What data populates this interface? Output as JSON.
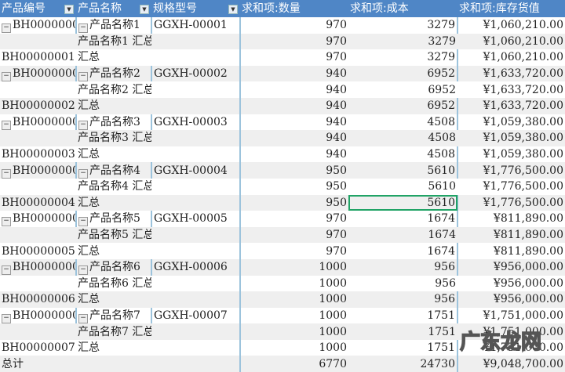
{
  "headers": [
    "产品编号",
    "产品名称",
    "规格型号",
    "求和项:数量",
    "求和项:成本",
    "求和项:库存货值"
  ],
  "rows": [
    {
      "c0": "BH0000000",
      "c0m": true,
      "c1": "产品名称1",
      "c1m": true,
      "c2": "GGXH-00001",
      "q": "970",
      "cost": "3279",
      "val": "¥1,060,210.00"
    },
    {
      "c0": "",
      "c1": "产品名称1 汇总",
      "c2": "",
      "q": "970",
      "cost": "3279",
      "val": "¥1,060,210.00"
    },
    {
      "c0": "BH00000001",
      "c1": "汇总",
      "c2": "",
      "q": "970",
      "cost": "3279",
      "val": "¥1,060,210.00"
    },
    {
      "c0": "BH0000000",
      "c0m": true,
      "c1": "产品名称2",
      "c1m": true,
      "c2": "GGXH-00002",
      "q": "940",
      "cost": "6952",
      "val": "¥1,633,720.00"
    },
    {
      "c0": "",
      "c1": "产品名称2 汇总",
      "c2": "",
      "q": "940",
      "cost": "6952",
      "val": "¥1,633,720.00"
    },
    {
      "c0": "BH00000002",
      "c1": "汇总",
      "c2": "",
      "q": "940",
      "cost": "6952",
      "val": "¥1,633,720.00"
    },
    {
      "c0": "BH0000000",
      "c0m": true,
      "c1": "产品名称3",
      "c1m": true,
      "c2": "GGXH-00003",
      "q": "940",
      "cost": "4508",
      "val": "¥1,059,380.00"
    },
    {
      "c0": "",
      "c1": "产品名称3 汇总",
      "c2": "",
      "q": "940",
      "cost": "4508",
      "val": "¥1,059,380.00"
    },
    {
      "c0": "BH00000003",
      "c1": "汇总",
      "c2": "",
      "q": "940",
      "cost": "4508",
      "val": "¥1,059,380.00"
    },
    {
      "c0": "BH0000000",
      "c0m": true,
      "c1": "产品名称4",
      "c1m": true,
      "c2": "GGXH-00004",
      "q": "950",
      "cost": "5610",
      "val": "¥1,776,500.00"
    },
    {
      "c0": "",
      "c1": "产品名称4 汇总",
      "c2": "",
      "q": "950",
      "cost": "5610",
      "val": "¥1,776,500.00"
    },
    {
      "c0": "BH00000004",
      "c1": "汇总",
      "c2": "",
      "q": "950",
      "cost": "5610",
      "val": "¥1,776,500.00",
      "selected": true
    },
    {
      "c0": "BH0000000",
      "c0m": true,
      "c1": "产品名称5",
      "c1m": true,
      "c2": "GGXH-00005",
      "q": "970",
      "cost": "1674",
      "val": "¥811,890.00"
    },
    {
      "c0": "",
      "c1": "产品名称5 汇总",
      "c2": "",
      "q": "970",
      "cost": "1674",
      "val": "¥811,890.00"
    },
    {
      "c0": "BH00000005",
      "c1": "汇总",
      "c2": "",
      "q": "970",
      "cost": "1674",
      "val": "¥811,890.00"
    },
    {
      "c0": "BH0000000",
      "c0m": true,
      "c1": "产品名称6",
      "c1m": true,
      "c2": "GGXH-00006",
      "q": "1000",
      "cost": "956",
      "val": "¥956,000.00"
    },
    {
      "c0": "",
      "c1": "产品名称6 汇总",
      "c2": "",
      "q": "1000",
      "cost": "956",
      "val": "¥956,000.00"
    },
    {
      "c0": "BH00000006",
      "c1": "汇总",
      "c2": "",
      "q": "1000",
      "cost": "956",
      "val": "¥956,000.00"
    },
    {
      "c0": "BH0000000",
      "c0m": true,
      "c1": "产品名称7",
      "c1m": true,
      "c2": "GGXH-00007",
      "q": "1000",
      "cost": "1751",
      "val": "¥1,751,000.00"
    },
    {
      "c0": "",
      "c1": "产品名称7 汇总",
      "c2": "",
      "q": "1000",
      "cost": "1751",
      "val": "¥1,751,000.00"
    },
    {
      "c0": "BH00000007",
      "c1": "汇总",
      "c2": "",
      "q": "1000",
      "cost": "1751",
      "val": "¥1,751,000.00"
    },
    {
      "c0": "总计",
      "c1": "",
      "c2": "",
      "q": "6770",
      "cost": "24730",
      "val": "¥9,048,700.00"
    }
  ],
  "watermark": "广东龙网",
  "colors": {
    "header": "#4f86c6",
    "selection": "#21a366"
  }
}
